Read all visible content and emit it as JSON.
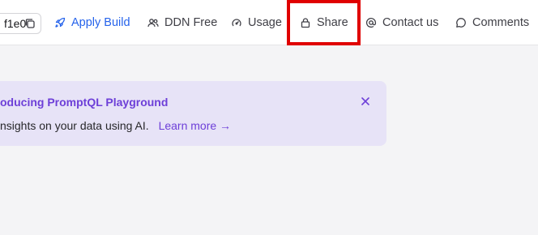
{
  "toolbar": {
    "project_id_fragment": "f1e0",
    "items": [
      {
        "label": "Apply Build",
        "icon": "rocket-icon"
      },
      {
        "label": "DDN Free",
        "icon": "users-icon"
      },
      {
        "label": "Usage",
        "icon": "gauge-icon"
      },
      {
        "label": "Share",
        "icon": "lock-icon"
      },
      {
        "label": "Contact us",
        "icon": "at-sign-icon"
      },
      {
        "label": "Comments",
        "icon": "chat-bubble-icon"
      }
    ]
  },
  "banner": {
    "title": "oducing PromptQL Playground",
    "body": "nsights on your data using AI.",
    "link": "Learn more →"
  },
  "colors": {
    "accent_blue": "#2563eb",
    "banner_bg": "#e7e3f7",
    "banner_accent": "#6d3fd8",
    "highlight_red": "#e00000"
  }
}
